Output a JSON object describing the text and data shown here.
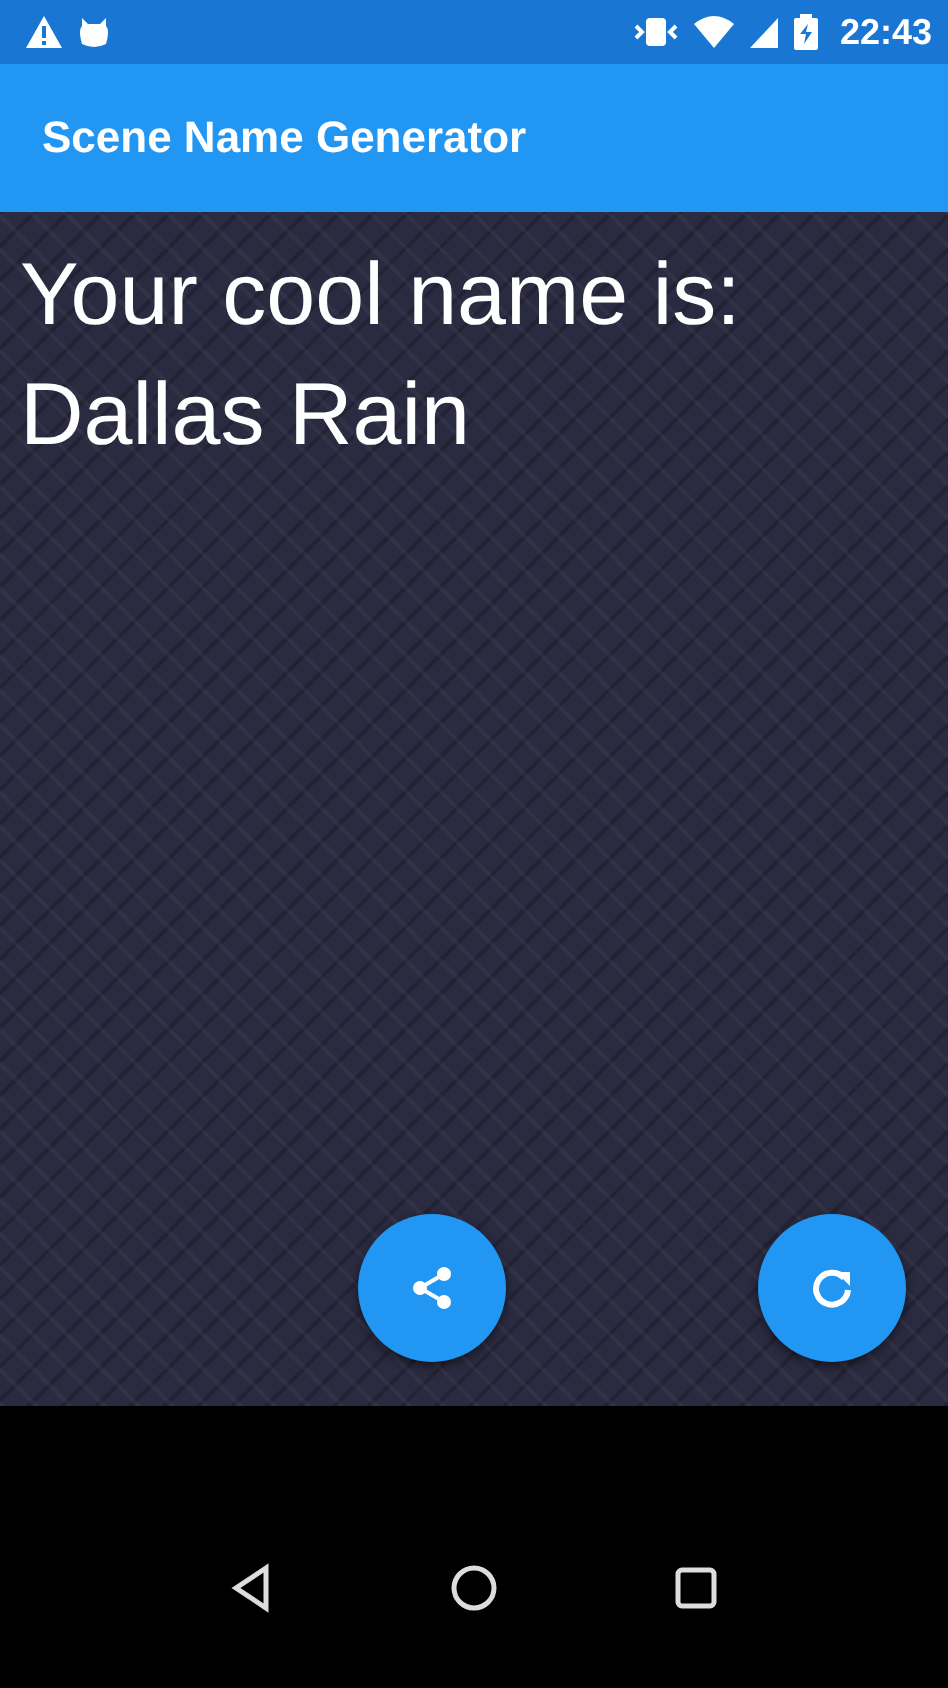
{
  "status_bar": {
    "time": "22:43"
  },
  "app_bar": {
    "title": "Scene Name Generator"
  },
  "content": {
    "heading": "Your cool name is:",
    "name": "Dallas Rain"
  }
}
